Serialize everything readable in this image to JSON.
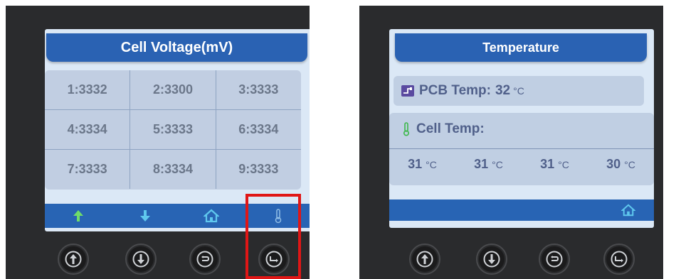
{
  "left_device": {
    "title": "Cell Voltage(mV)",
    "cells": [
      [
        "1:3332",
        "2:3300",
        "3:3333"
      ],
      [
        "4:3334",
        "5:3333",
        "6:3334"
      ],
      [
        "7:3333",
        "8:3334",
        "9:3333"
      ]
    ],
    "nav_icons": [
      "arrow-up-icon",
      "arrow-down-icon",
      "home-icon",
      "thermometer-icon"
    ],
    "highlighted_button": "return-button"
  },
  "right_device": {
    "title": "Temperature",
    "pcb_label": "PCB Temp:",
    "pcb_value": "32",
    "pcb_unit": "°C",
    "cell_label": "Cell Temp:",
    "cell_values": [
      {
        "value": "31",
        "unit": "°C"
      },
      {
        "value": "31",
        "unit": "°C"
      },
      {
        "value": "31",
        "unit": "°C"
      },
      {
        "value": "30",
        "unit": "°C"
      }
    ],
    "nav_icons": [
      "home-icon"
    ]
  },
  "hardware_buttons": [
    "up-button",
    "down-button",
    "back-button",
    "return-button"
  ],
  "colors": {
    "screen_bg": "#dbe8f6",
    "title_bar": "#2a62b3",
    "grid_bg": "#c1cee2",
    "highlight": "#e01616",
    "nav_green": "#6fdc6a",
    "nav_cyan": "#5fc8ee"
  }
}
